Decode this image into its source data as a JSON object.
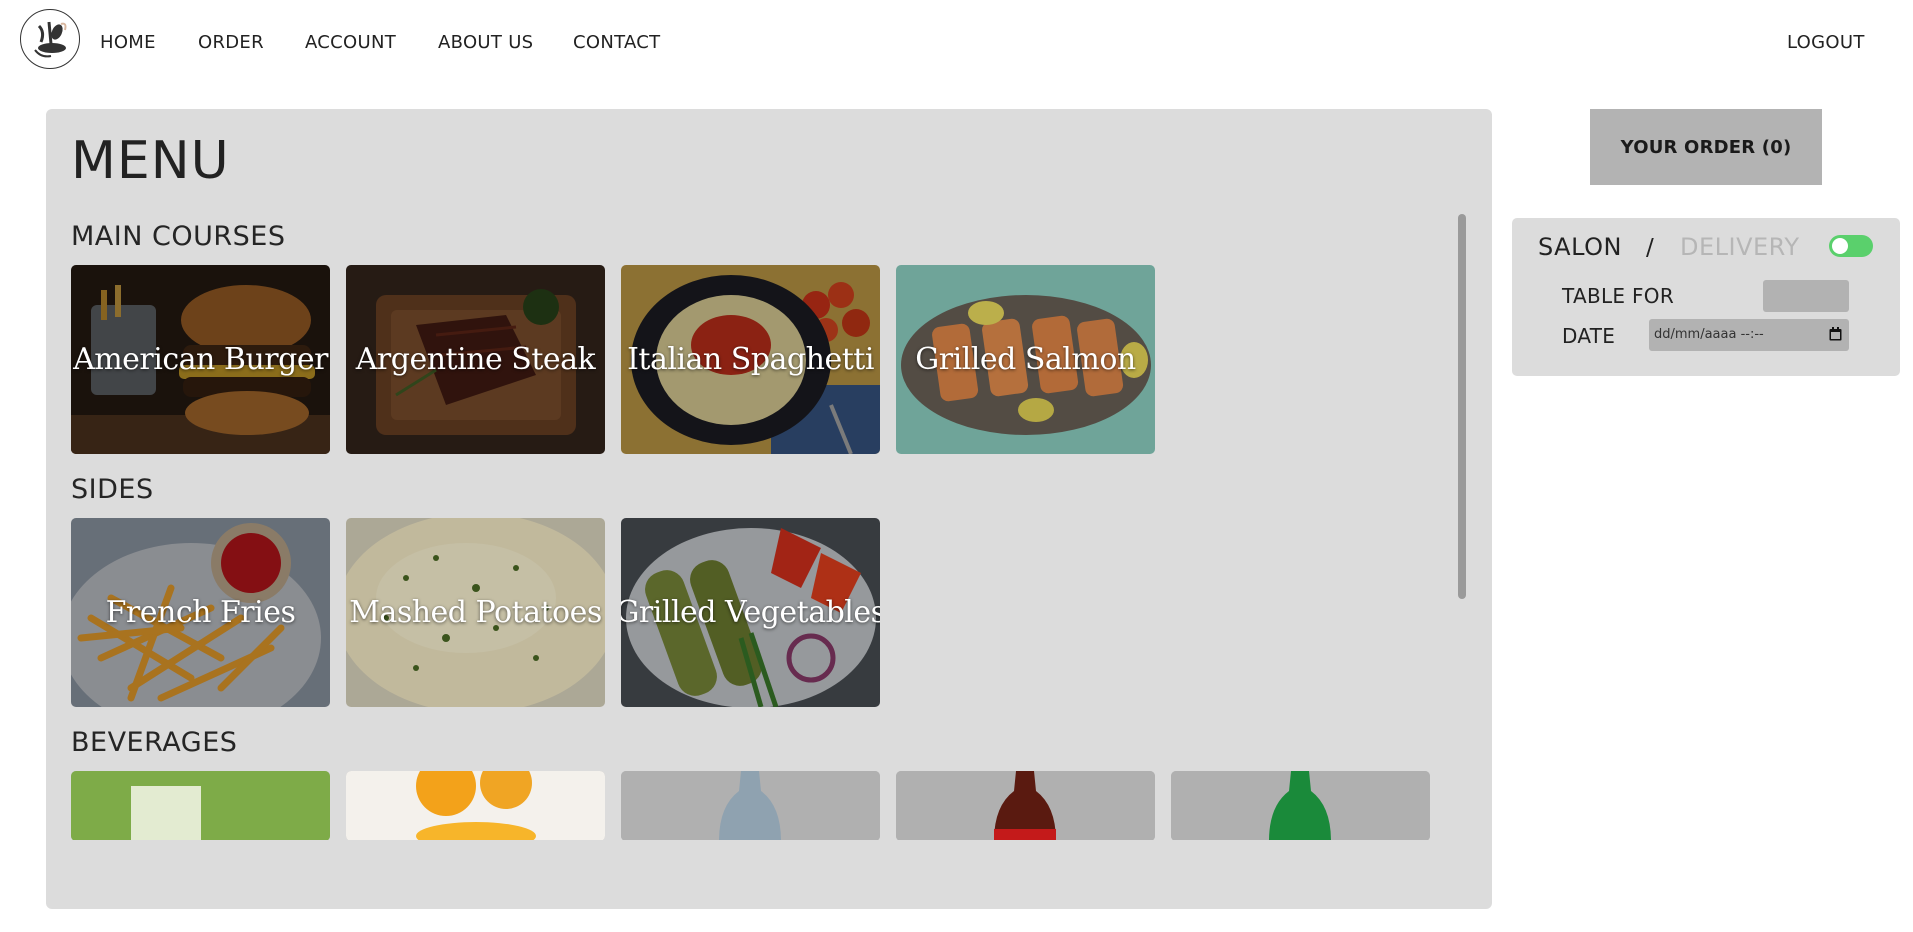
{
  "nav": {
    "logo_icon": "fork-spoon-leaf-logo",
    "links": [
      "HOME",
      "ORDER",
      "ACCOUNT",
      "ABOUT US",
      "CONTACT"
    ],
    "logout": "LOGOUT"
  },
  "menu": {
    "title": "MENU",
    "sections": {
      "main": {
        "title": "MAIN COURSES",
        "items": [
          "American Burger",
          "Argentine Steak",
          "Italian Spaghetti",
          "Grilled Salmon"
        ]
      },
      "sides": {
        "title": "SIDES",
        "items": [
          "French Fries",
          "Mashed Potatoes",
          "Grilled Vegetables"
        ]
      },
      "beverages": {
        "title": "BEVERAGES"
      }
    }
  },
  "order": {
    "button_label": "YOUR ORDER (0)",
    "salon": "SALON",
    "separator": "/",
    "delivery": "DELIVERY",
    "toggle_color": "#5ad06c",
    "table_for_label": "TABLE FOR",
    "date_label": "DATE",
    "date_placeholder": "dd/mm/aaaa --:--"
  },
  "colors": {
    "panel": "#dcdcdc",
    "order_button": "#b3b3b3",
    "input": "#b2b2b2",
    "delivery_inactive": "#b6b6b6"
  }
}
